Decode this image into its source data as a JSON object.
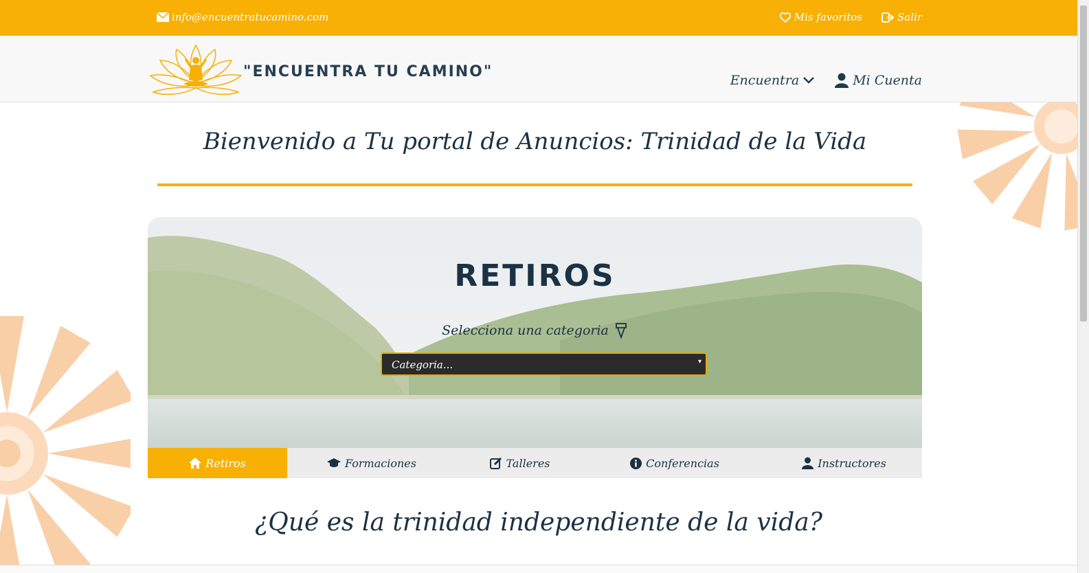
{
  "topbar": {
    "email": "info@encuentratucamino.com",
    "favorites": "Mis favoritos",
    "logout": "Salir"
  },
  "navbar": {
    "brand": "\"ENCUENTRA TU CAMINO\"",
    "encuentra": "Encuentra",
    "account": "Mi Cuenta"
  },
  "main": {
    "welcome": "Bienvenido a Tu portal de Anuncios: Trinidad de la Vida",
    "hero_title": "RETIROS",
    "hero_subtitle": "Selecciona una categoria",
    "select_value": "Categoria...",
    "tabs": [
      {
        "label": "Retiros",
        "icon": "home-icon"
      },
      {
        "label": "Formaciones",
        "icon": "graduation-cap-icon"
      },
      {
        "label": "Talleres",
        "icon": "edit-icon"
      },
      {
        "label": "Conferencias",
        "icon": "info-icon"
      },
      {
        "label": "Instructores",
        "icon": "user-icon"
      }
    ],
    "question": "¿Qué es la trinidad independiente de la vida?"
  },
  "colors": {
    "accent": "#f7b003",
    "navy": "#1b3144",
    "mandala": "#f9c79a"
  }
}
